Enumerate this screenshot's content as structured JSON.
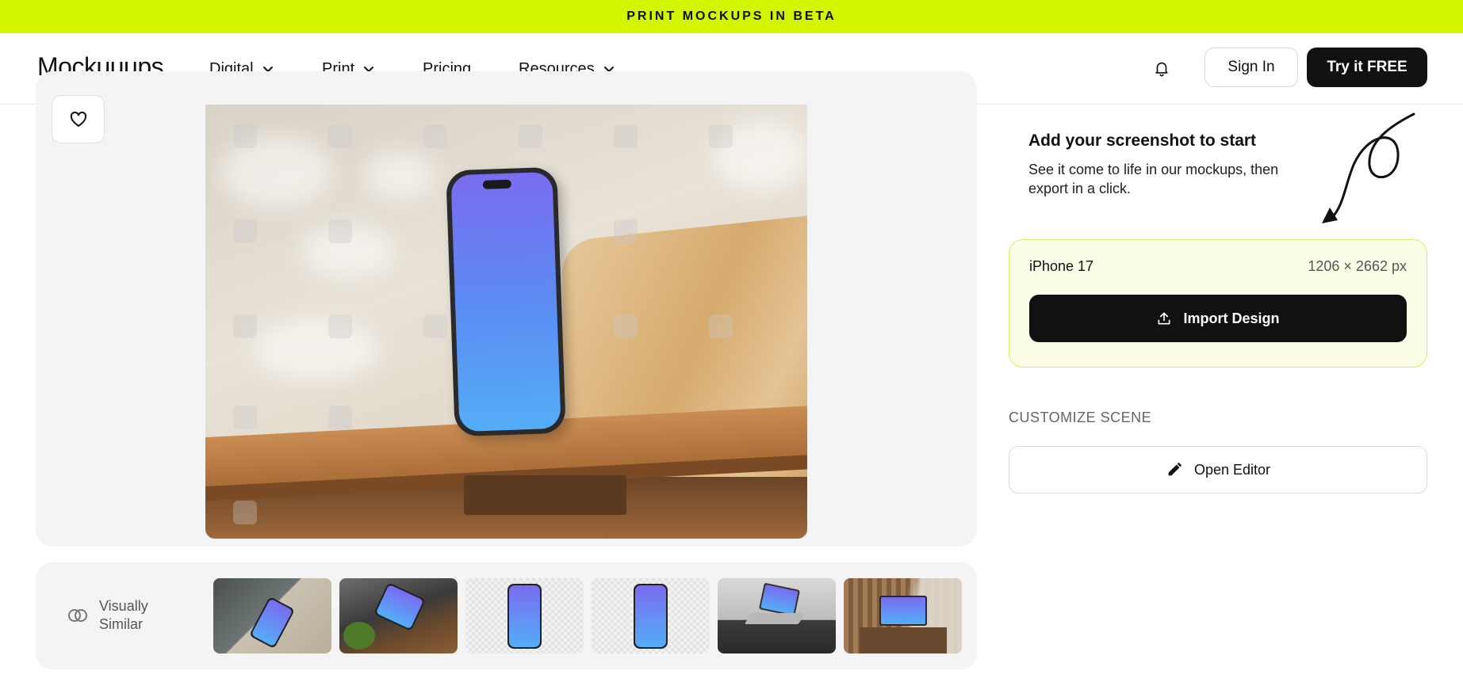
{
  "banner": {
    "text": "PRINT MOCKUPS IN BETA"
  },
  "nav": {
    "logo": "Mockuuups",
    "items": [
      {
        "label": "Digital",
        "has_dropdown": true
      },
      {
        "label": "Print",
        "has_dropdown": true
      },
      {
        "label": "Pricing",
        "has_dropdown": false
      },
      {
        "label": "Resources",
        "has_dropdown": true
      }
    ],
    "notification_icon": "bell-icon",
    "sign_in": "Sign In",
    "try_free": "Try it FREE"
  },
  "preview": {
    "favorite_icon": "heart-icon"
  },
  "sidebar": {
    "add_title": "Add your screenshot to start",
    "add_subtitle": "See it come to life in our mockups, then export in a click.",
    "device": {
      "name": "iPhone 17",
      "size": "1206 × 2662 px"
    },
    "import_button": "Import Design",
    "import_icon": "upload-icon",
    "customize_label": "CUSTOMIZE SCENE",
    "editor_button": "Open Editor",
    "editor_icon": "pencil-icon"
  },
  "similar": {
    "label": "Visually Similar",
    "icon": "overlap-circles-icon"
  },
  "colors": {
    "banner": "#d4f500",
    "primary_button": "#111111",
    "device_card_bg": "#fbfde6",
    "device_card_border": "#dde96a"
  }
}
